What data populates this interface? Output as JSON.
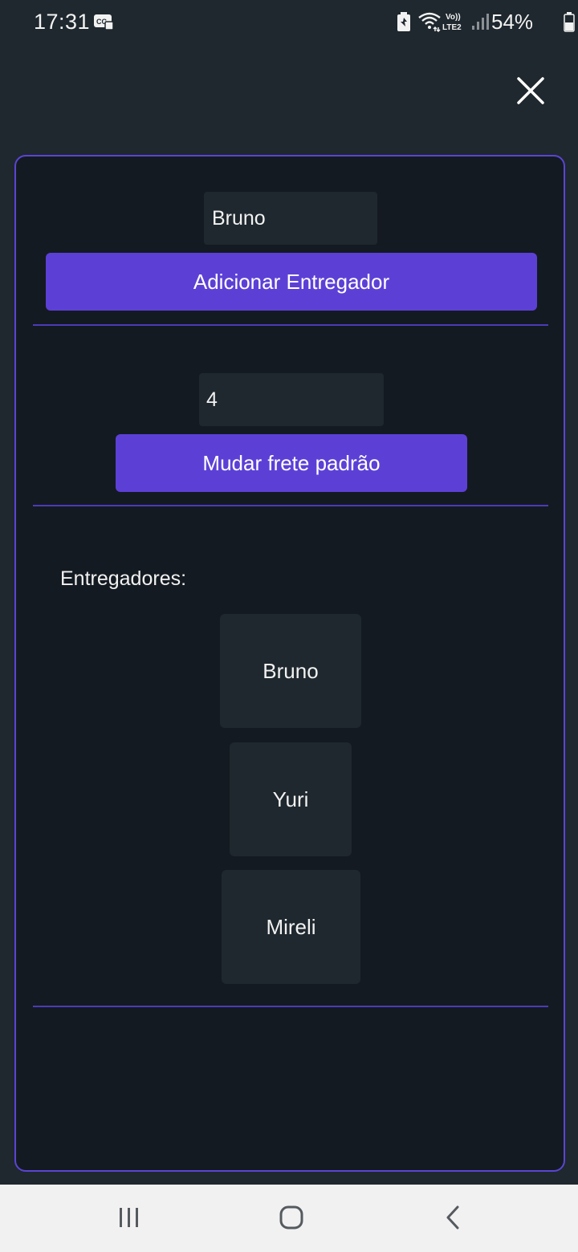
{
  "status_bar": {
    "time": "17:31",
    "battery_percent": "54%",
    "volte_label": "Vo))",
    "lte_label": "LTE2",
    "icons": [
      "caption-icon",
      "battery-saver-icon",
      "wifi-icon",
      "volte-icon",
      "signal-icon",
      "battery-icon"
    ]
  },
  "header": {
    "close_icon": "close-icon"
  },
  "add_courier": {
    "name_value": "Bruno",
    "button_label": "Adicionar Entregador"
  },
  "default_freight": {
    "value": "4",
    "button_label": "Mudar frete padrão"
  },
  "couriers": {
    "heading": "Entregadores:",
    "items": [
      {
        "name": "Bruno"
      },
      {
        "name": "Yuri"
      },
      {
        "name": "Mireli"
      }
    ]
  },
  "nav_bar": {
    "icons": [
      "recents-icon",
      "home-icon",
      "back-icon"
    ]
  },
  "colors": {
    "background": "#1f282e",
    "card_background": "#141a21",
    "accent": "#5c40d6",
    "border": "#5b44d4",
    "input_background": "#1f282e",
    "nav_background": "#f1f1f1"
  }
}
